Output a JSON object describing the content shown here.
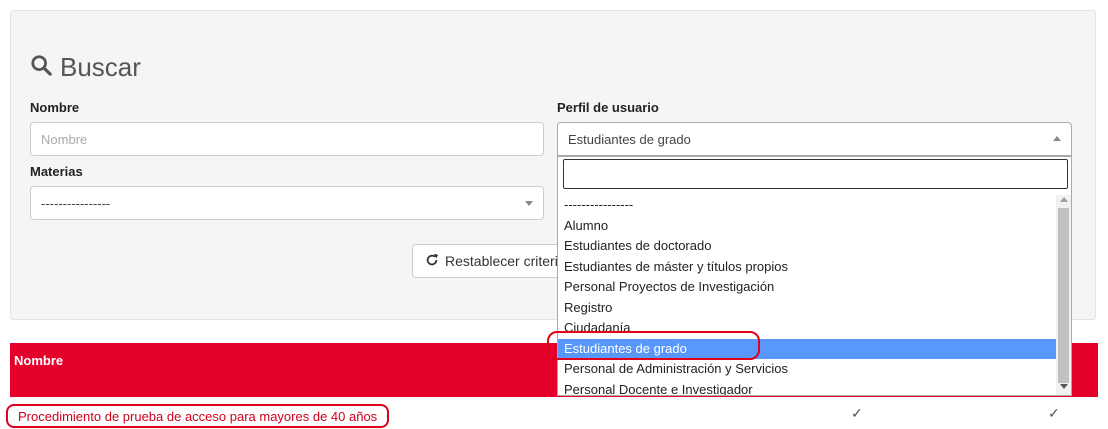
{
  "search": {
    "title": "Buscar",
    "nombre_label": "Nombre",
    "nombre_placeholder": "Nombre",
    "materias_label": "Materias",
    "materias_value": "----------------",
    "perfil_label": "Perfil de usuario",
    "perfil_value": "Estudiantes de grado",
    "reset_button": "Restablecer criteri"
  },
  "dropdown": {
    "options": [
      "----------------",
      "Alumno",
      "Estudiantes de doctorado",
      "Estudiantes de máster y títulos propios",
      "Personal Proyectos de Investigación",
      "Registro",
      "Ciudadanía",
      "Estudiantes de grado",
      "Personal de Administración y Servicios",
      "Personal Docente e Investigador"
    ],
    "selected_index": 7
  },
  "table": {
    "header": "Nombre",
    "rows": [
      {
        "name": "Procedimiento de prueba de acceso para mayores de 40 años",
        "check1": "✓",
        "check2": "✓"
      }
    ]
  },
  "colors": {
    "accent": "#e4002b",
    "selected": "#5897fb"
  }
}
